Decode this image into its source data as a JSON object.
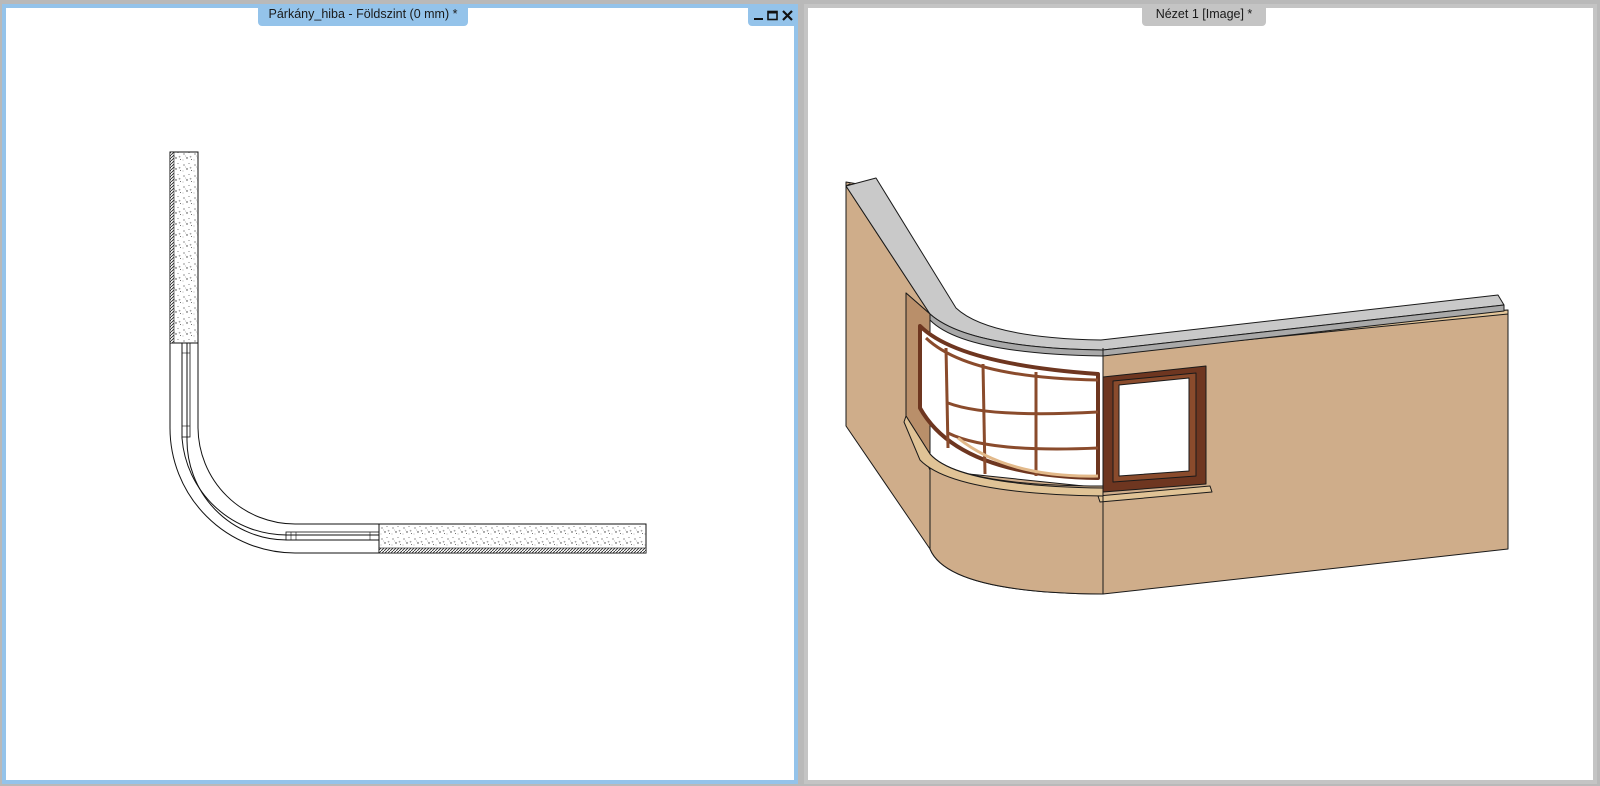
{
  "left_pane": {
    "tab_title": "Párkány_hiba - Földszint (0 mm) *",
    "view": "floor-plan",
    "controls": {
      "minimize_icon": "minimize-icon",
      "restore_icon": "restore-icon",
      "close_icon": "close-icon"
    }
  },
  "right_pane": {
    "tab_title": "Nézet 1 [Image] *",
    "view": "3d-rendered-view"
  },
  "colors": {
    "active_frame": "#94c3ea",
    "inactive_frame": "#c4c4c4",
    "wall": "#cfad8a",
    "sill": "#c8c8c8",
    "window_frame": "#7a3f26"
  }
}
